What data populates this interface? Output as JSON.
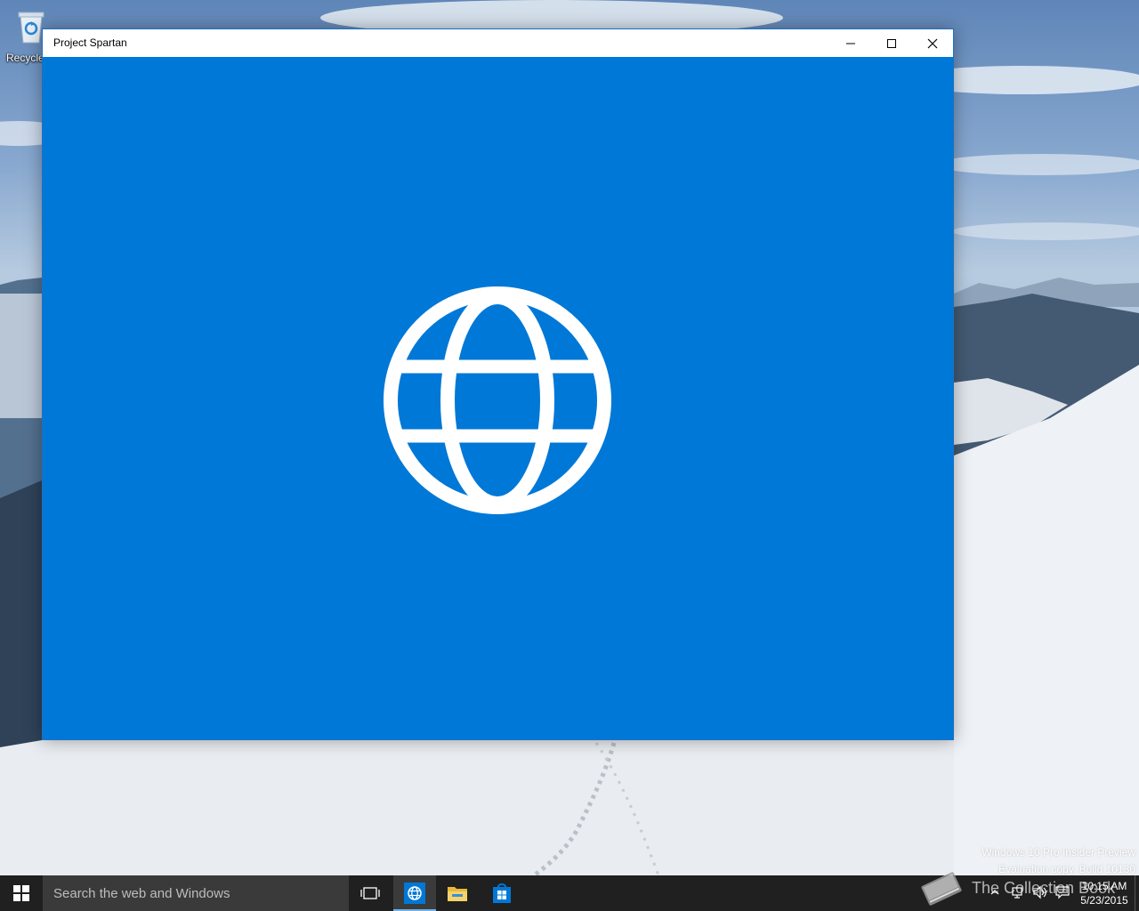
{
  "desktop": {
    "icons": [
      {
        "label": "Recycle",
        "icon": "recycle-bin-icon"
      }
    ]
  },
  "window": {
    "title": "Project Spartan",
    "controls": {
      "minimize": "minimize-icon",
      "maximize": "maximize-icon",
      "close": "close-icon"
    },
    "splash_icon": "globe-icon",
    "splash_color": "#0078d7"
  },
  "watermark": {
    "line1": "Windows 10 Pro Insider Preview",
    "line2": "Evaluation copy. Build 10130"
  },
  "taskbar": {
    "start_icon": "windows-logo-icon",
    "search_placeholder": "Search the web and Windows",
    "pinned": [
      {
        "name": "task-view",
        "icon": "task-view-icon",
        "active": false
      },
      {
        "name": "project-spartan",
        "icon": "globe-icon",
        "active": true
      },
      {
        "name": "file-explorer",
        "icon": "folder-icon",
        "active": false
      },
      {
        "name": "store",
        "icon": "store-icon",
        "active": false
      }
    ],
    "branding": "The Collection Book",
    "tray": {
      "icons": [
        "chevron-up-icon",
        "network-icon",
        "volume-icon",
        "action-center-icon"
      ],
      "time": "10:15 AM",
      "date": "5/23/2015"
    }
  },
  "colors": {
    "accent": "#0078d7",
    "taskbar": "#202020",
    "search": "#3a3a3a"
  }
}
